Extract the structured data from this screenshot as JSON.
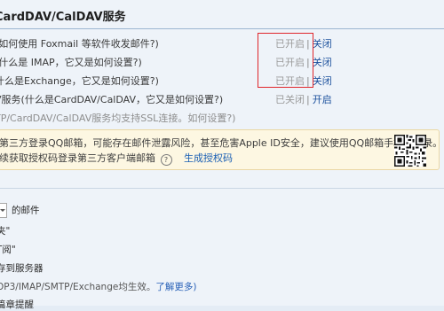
{
  "section": {
    "title": "CardDAV/CalDAV服务"
  },
  "services": [
    {
      "label": "(如何使用 Foxmail 等软件收发邮件?)",
      "state": "已开启",
      "action": "关闭"
    },
    {
      "label": "(什么是 IMAP，它又是如何设置?)",
      "state": "已开启",
      "action": "关闭"
    },
    {
      "label": "什么是Exchange，它又是如何设置?)",
      "state": "已开启",
      "action": "关闭"
    },
    {
      "label_prefix": "V服务",
      "label_link": "(什么是CardDAV/CalDAV，它又是如何设置?)",
      "state": "已关闭",
      "action": "开启"
    }
  ],
  "ssl_note": "TP/CardDAV/CalDAV服务均支持SSL连接。如何设置?)",
  "status_separator": "|",
  "notice": {
    "line1": "第三方登录QQ邮箱，可能存在邮件泄露风险，甚至危害Apple ID安全，建议使用QQ邮箱手机版登录。",
    "line2": "续获取授权码登录第三方客户端邮箱",
    "help_glyph": "?",
    "link": "生成授权码",
    "qr_icon": "qr-code-icon"
  },
  "options": [
    {
      "text": "的邮件",
      "has_select": true
    },
    {
      "text": "夹\""
    },
    {
      "text": "T阅\""
    },
    {
      "text": "存到服务器"
    },
    {
      "text": "OP3/IMAP/SMTP/Exchange均生效。",
      "link": "了解更多)"
    },
    {
      "text": "篇章提醒"
    }
  ],
  "colors": {
    "link": "#1a4f9c",
    "highlight_box": "#e0262b",
    "notice_bg": "#fdf7e2"
  }
}
